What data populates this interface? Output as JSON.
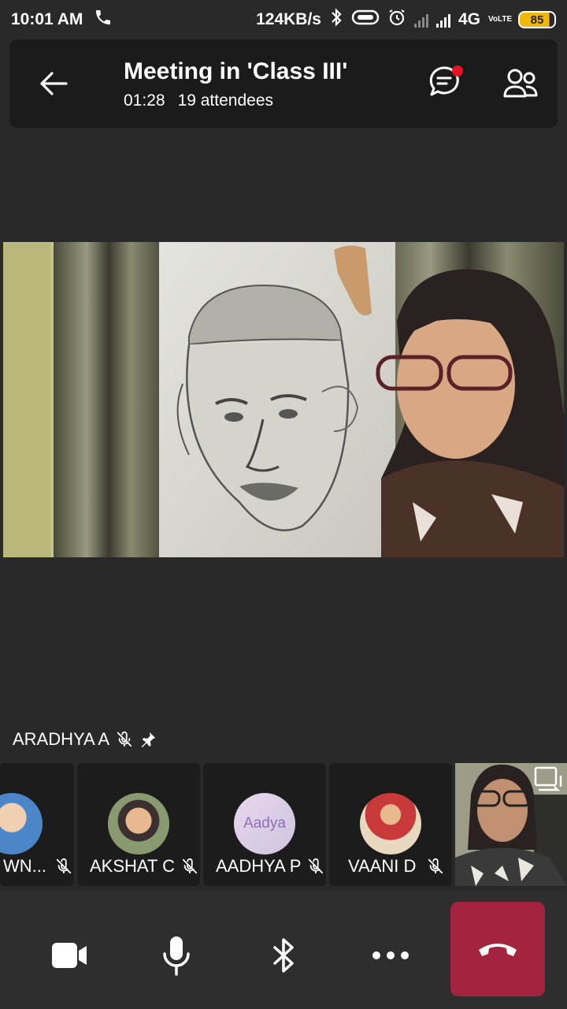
{
  "status": {
    "time": "10:01 AM",
    "speed": "124KB/s",
    "network": "4G",
    "volte": "VoLTE",
    "battery": "85"
  },
  "header": {
    "title": "Meeting in 'Class III'",
    "duration": "01:28",
    "attendees": "19 attendees"
  },
  "main": {
    "speaker": "ARADHYA A"
  },
  "thumbnails": [
    {
      "name": "WN..."
    },
    {
      "name": "AKSHAT C"
    },
    {
      "name": "AADHYA P",
      "avatar_text": "Aadya"
    },
    {
      "name": "VAANI D"
    }
  ],
  "colors": {
    "background": "#292929",
    "header": "#1b1b1b",
    "hangup": "#a4233e",
    "notification": "#e81123"
  },
  "icons": [
    "back-arrow-icon",
    "chat-icon",
    "people-icon",
    "mic-off-icon",
    "pin-icon",
    "camera-icon",
    "microphone-icon",
    "bluetooth-icon",
    "more-icon",
    "hangup-icon",
    "switch-camera-icon"
  ]
}
